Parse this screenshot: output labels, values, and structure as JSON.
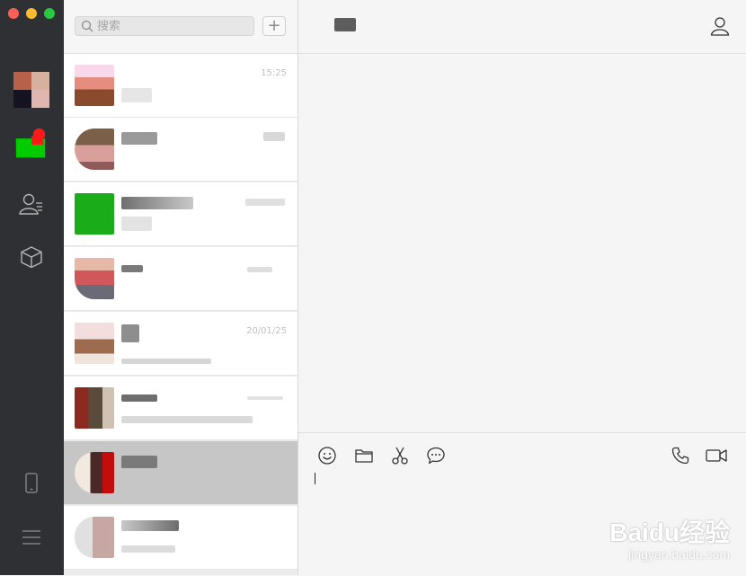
{
  "window": {
    "traffic_lights": [
      "close",
      "minimize",
      "zoom"
    ]
  },
  "nav": {
    "items": [
      {
        "icon": "chat-icon",
        "active": true
      },
      {
        "icon": "contacts-icon"
      },
      {
        "icon": "box-icon"
      },
      {
        "icon": "phone-icon"
      },
      {
        "icon": "menu-icon"
      }
    ]
  },
  "search": {
    "placeholder": "搜索"
  },
  "add_button": {
    "label": "+"
  },
  "chats": [
    {
      "name": "",
      "time": "15:25",
      "preview": ""
    },
    {
      "name": "",
      "time": "",
      "preview": ""
    },
    {
      "name": "",
      "time": "",
      "preview": ""
    },
    {
      "name": "",
      "time": "",
      "preview": ""
    },
    {
      "name": "",
      "time": "20/01/25",
      "preview": ""
    },
    {
      "name": "",
      "time": "",
      "preview": ""
    },
    {
      "name": "",
      "time": "",
      "preview": "",
      "selected": true
    },
    {
      "name": "",
      "time": "",
      "preview": ""
    }
  ],
  "chat_header": {
    "title": ""
  },
  "composer": {
    "tools": [
      "emoji-icon",
      "folder-icon",
      "scissors-icon",
      "speech-bubble-icon",
      "phone-call-icon",
      "video-call-icon"
    ]
  },
  "watermark": {
    "logo": "Baidu经验",
    "url": "jingyan.baidu.com"
  },
  "colors": {
    "nav_bg": "#2e3033",
    "list_bg": "#ececec",
    "selected_bg": "#c6c6c6",
    "main_bg": "#f5f5f5",
    "accent_green": "#1aad19"
  }
}
